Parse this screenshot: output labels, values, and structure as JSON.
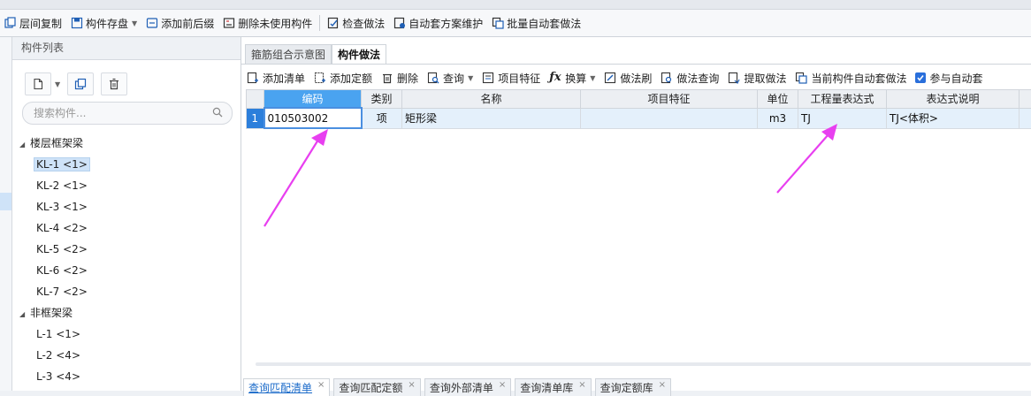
{
  "toolbar_main": {
    "items": [
      {
        "label": "层间复制",
        "icon": "layer-copy-icon"
      },
      {
        "label": "构件存盘",
        "icon": "component-save-icon",
        "dropdown": true
      },
      {
        "label": "添加前后缀",
        "icon": "add-affix-icon"
      },
      {
        "label": "删除未使用构件",
        "icon": "delete-unused-icon"
      },
      {
        "label": "检查做法",
        "icon": "check-method-icon"
      },
      {
        "label": "自动套方案维护",
        "icon": "auto-scheme-icon"
      },
      {
        "label": "批量自动套做法",
        "icon": "batch-auto-icon"
      }
    ]
  },
  "component_list": {
    "title": "构件列表",
    "search_placeholder": "搜索构件...",
    "groups": [
      {
        "label": "楼层框架梁",
        "items": [
          "KL-1 <1>",
          "KL-2 <1>",
          "KL-3 <1>",
          "KL-4 <2>",
          "KL-5 <2>",
          "KL-6 <2>",
          "KL-7 <2>"
        ]
      },
      {
        "label": "非框架梁",
        "items": [
          "L-1 <1>",
          "L-2 <4>",
          "L-3 <4>"
        ]
      }
    ]
  },
  "tabs": [
    "箍筋组合示意图",
    "构件做法"
  ],
  "toolbar_method": {
    "items": [
      {
        "label": "添加清单",
        "icon": "add-list-icon"
      },
      {
        "label": "添加定额",
        "icon": "add-quota-icon"
      },
      {
        "label": "删除",
        "icon": "trash-icon"
      },
      {
        "label": "查询",
        "icon": "query-icon",
        "dropdown": true
      },
      {
        "label": "项目特征",
        "icon": "project-feature-icon"
      },
      {
        "label": "换算",
        "icon": "fx-icon",
        "dropdown": true
      },
      {
        "label": "做法刷",
        "icon": "method-brush-icon"
      },
      {
        "label": "做法查询",
        "icon": "method-query-icon"
      },
      {
        "label": "提取做法",
        "icon": "extract-method-icon"
      },
      {
        "label": "当前构件自动套做法",
        "icon": "auto-apply-icon"
      }
    ],
    "checkbox_label": "参与自动套"
  },
  "table": {
    "headers": [
      "编码",
      "类别",
      "名称",
      "项目特征",
      "单位",
      "工程量表达式",
      "表达式说明"
    ],
    "rows": [
      {
        "num": "1",
        "code": "010503002",
        "type": "项",
        "name": "矩形梁",
        "feature": "",
        "unit": "m3",
        "expr": "TJ",
        "desc": "TJ<体积>"
      }
    ]
  },
  "bottom_tabs": [
    "查询匹配清单",
    "查询匹配定额",
    "查询外部清单",
    "查询清单库",
    "查询定额库"
  ],
  "colors": {
    "accent": "#2c7fdb",
    "header_highlight": "#4aa3f0",
    "arrow": "#e83ff0"
  }
}
